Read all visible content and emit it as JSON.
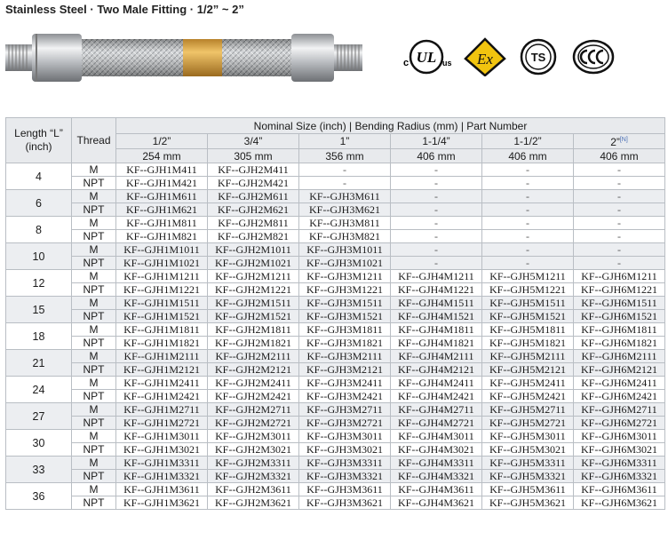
{
  "title": "Stainless Steel · Two Male Fitting · 1/2” ~ 2”",
  "certs": {
    "ul": {
      "c": "c",
      "ul": "UL",
      "us": "us"
    },
    "ex": "Ex",
    "ts": "TS"
  },
  "table": {
    "header_length": "Length “L” (inch)",
    "header_thread": "Thread",
    "header_group": "Nominal Size (inch) | Bending Radius (mm) | Part Number",
    "sizes": [
      {
        "size": "1/2”",
        "radius": "254 mm"
      },
      {
        "size": "3/4”",
        "radius": "305 mm"
      },
      {
        "size": "1”",
        "radius": "356 mm"
      },
      {
        "size": "1-1/4”",
        "radius": "406 mm"
      },
      {
        "size": "1-1/2”",
        "radius": "406 mm"
      },
      {
        "size": "2”",
        "radius": "406 mm",
        "note": "[N]"
      }
    ],
    "rows": [
      {
        "length": "4",
        "threads": [
          {
            "thread": "M",
            "parts": [
              "KF--GJH1M411",
              "KF--GJH2M411",
              "-",
              "-",
              "-",
              "-"
            ]
          },
          {
            "thread": "NPT",
            "parts": [
              "KF--GJH1M421",
              "KF--GJH2M421",
              "-",
              "-",
              "-",
              "-"
            ]
          }
        ]
      },
      {
        "length": "6",
        "threads": [
          {
            "thread": "M",
            "parts": [
              "KF--GJH1M611",
              "KF--GJH2M611",
              "KF--GJH3M611",
              "-",
              "-",
              "-"
            ]
          },
          {
            "thread": "NPT",
            "parts": [
              "KF--GJH1M621",
              "KF--GJH2M621",
              "KF--GJH3M621",
              "-",
              "-",
              "-"
            ]
          }
        ]
      },
      {
        "length": "8",
        "threads": [
          {
            "thread": "M",
            "parts": [
              "KF--GJH1M811",
              "KF--GJH2M811",
              "KF--GJH3M811",
              "-",
              "-",
              "-"
            ]
          },
          {
            "thread": "NPT",
            "parts": [
              "KF--GJH1M821",
              "KF--GJH2M821",
              "KF--GJH3M821",
              "-",
              "-",
              "-"
            ]
          }
        ]
      },
      {
        "length": "10",
        "threads": [
          {
            "thread": "M",
            "parts": [
              "KF--GJH1M1011",
              "KF--GJH2M1011",
              "KF--GJH3M1011",
              "-",
              "-",
              "-"
            ]
          },
          {
            "thread": "NPT",
            "parts": [
              "KF--GJH1M1021",
              "KF--GJH2M1021",
              "KF--GJH3M1021",
              "-",
              "-",
              "-"
            ]
          }
        ]
      },
      {
        "length": "12",
        "threads": [
          {
            "thread": "M",
            "parts": [
              "KF--GJH1M1211",
              "KF--GJH2M1211",
              "KF--GJH3M1211",
              "KF--GJH4M1211",
              "KF--GJH5M1211",
              "KF--GJH6M1211"
            ]
          },
          {
            "thread": "NPT",
            "parts": [
              "KF--GJH1M1221",
              "KF--GJH2M1221",
              "KF--GJH3M1221",
              "KF--GJH4M1221",
              "KF--GJH5M1221",
              "KF--GJH6M1221"
            ]
          }
        ]
      },
      {
        "length": "15",
        "threads": [
          {
            "thread": "M",
            "parts": [
              "KF--GJH1M1511",
              "KF--GJH2M1511",
              "KF--GJH3M1511",
              "KF--GJH4M1511",
              "KF--GJH5M1511",
              "KF--GJH6M1511"
            ]
          },
          {
            "thread": "NPT",
            "parts": [
              "KF--GJH1M1521",
              "KF--GJH2M1521",
              "KF--GJH3M1521",
              "KF--GJH4M1521",
              "KF--GJH5M1521",
              "KF--GJH6M1521"
            ]
          }
        ]
      },
      {
        "length": "18",
        "threads": [
          {
            "thread": "M",
            "parts": [
              "KF--GJH1M1811",
              "KF--GJH2M1811",
              "KF--GJH3M1811",
              "KF--GJH4M1811",
              "KF--GJH5M1811",
              "KF--GJH6M1811"
            ]
          },
          {
            "thread": "NPT",
            "parts": [
              "KF--GJH1M1821",
              "KF--GJH2M1821",
              "KF--GJH3M1821",
              "KF--GJH4M1821",
              "KF--GJH5M1821",
              "KF--GJH6M1821"
            ]
          }
        ]
      },
      {
        "length": "21",
        "threads": [
          {
            "thread": "M",
            "parts": [
              "KF--GJH1M2111",
              "KF--GJH2M2111",
              "KF--GJH3M2111",
              "KF--GJH4M2111",
              "KF--GJH5M2111",
              "KF--GJH6M2111"
            ]
          },
          {
            "thread": "NPT",
            "parts": [
              "KF--GJH1M2121",
              "KF--GJH2M2121",
              "KF--GJH3M2121",
              "KF--GJH4M2121",
              "KF--GJH5M2121",
              "KF--GJH6M2121"
            ]
          }
        ]
      },
      {
        "length": "24",
        "threads": [
          {
            "thread": "M",
            "parts": [
              "KF--GJH1M2411",
              "KF--GJH2M2411",
              "KF--GJH3M2411",
              "KF--GJH4M2411",
              "KF--GJH5M2411",
              "KF--GJH6M2411"
            ]
          },
          {
            "thread": "NPT",
            "parts": [
              "KF--GJH1M2421",
              "KF--GJH2M2421",
              "KF--GJH3M2421",
              "KF--GJH4M2421",
              "KF--GJH5M2421",
              "KF--GJH6M2421"
            ]
          }
        ]
      },
      {
        "length": "27",
        "threads": [
          {
            "thread": "M",
            "parts": [
              "KF--GJH1M2711",
              "KF--GJH2M2711",
              "KF--GJH3M2711",
              "KF--GJH4M2711",
              "KF--GJH5M2711",
              "KF--GJH6M2711"
            ]
          },
          {
            "thread": "NPT",
            "parts": [
              "KF--GJH1M2721",
              "KF--GJH2M2721",
              "KF--GJH3M2721",
              "KF--GJH4M2721",
              "KF--GJH5M2721",
              "KF--GJH6M2721"
            ]
          }
        ]
      },
      {
        "length": "30",
        "threads": [
          {
            "thread": "M",
            "parts": [
              "KF--GJH1M3011",
              "KF--GJH2M3011",
              "KF--GJH3M3011",
              "KF--GJH4M3011",
              "KF--GJH5M3011",
              "KF--GJH6M3011"
            ]
          },
          {
            "thread": "NPT",
            "parts": [
              "KF--GJH1M3021",
              "KF--GJH2M3021",
              "KF--GJH3M3021",
              "KF--GJH4M3021",
              "KF--GJH5M3021",
              "KF--GJH6M3021"
            ]
          }
        ]
      },
      {
        "length": "33",
        "threads": [
          {
            "thread": "M",
            "parts": [
              "KF--GJH1M3311",
              "KF--GJH2M3311",
              "KF--GJH3M3311",
              "KF--GJH4M3311",
              "KF--GJH5M3311",
              "KF--GJH6M3311"
            ]
          },
          {
            "thread": "NPT",
            "parts": [
              "KF--GJH1M3321",
              "KF--GJH2M3321",
              "KF--GJH3M3321",
              "KF--GJH4M3321",
              "KF--GJH5M3321",
              "KF--GJH6M3321"
            ]
          }
        ]
      },
      {
        "length": "36",
        "threads": [
          {
            "thread": "M",
            "parts": [
              "KF--GJH1M3611",
              "KF--GJH2M3611",
              "KF--GJH3M3611",
              "KF--GJH4M3611",
              "KF--GJH5M3611",
              "KF--GJH6M3611"
            ]
          },
          {
            "thread": "NPT",
            "parts": [
              "KF--GJH1M3621",
              "KF--GJH2M3621",
              "KF--GJH3M3621",
              "KF--GJH4M3621",
              "KF--GJH5M3621",
              "KF--GJH6M3621"
            ]
          }
        ]
      }
    ]
  }
}
